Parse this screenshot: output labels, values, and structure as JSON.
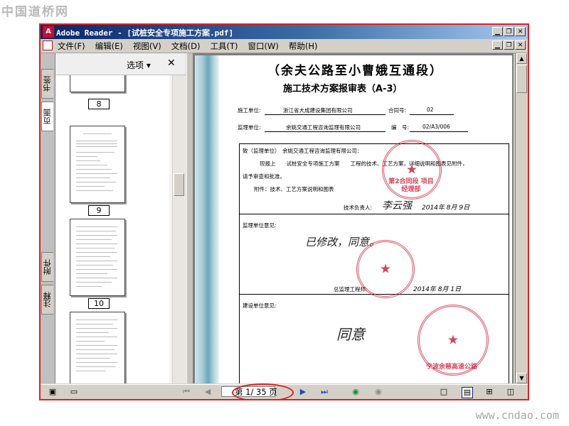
{
  "watermarks": {
    "top": "中国道桥网",
    "bottom": "www.cndao.com"
  },
  "window": {
    "title": "Adobe Reader - [试桩安全专项施工方案.pdf]",
    "controls": {
      "minimize": "▁",
      "restore": "❐",
      "close": "✕"
    }
  },
  "menu": {
    "items": [
      "文件(F)",
      "编辑(E)",
      "视图(V)",
      "文档(D)",
      "工具(T)",
      "窗口(W)",
      "帮助(H)"
    ]
  },
  "side_tabs": {
    "bookmarks": "书签",
    "pages": "页面",
    "attachments": "附件",
    "comments": "注释"
  },
  "panel": {
    "options_label": "选项 ▾",
    "close_label": "✕",
    "page_numbers": [
      "8",
      "9",
      "10"
    ]
  },
  "document": {
    "title": "（余夫公路至小曹娥互通段）",
    "subtitle": "施工技术方案报审表（A-3）",
    "construction_unit_label": "施工单位:",
    "construction_unit": "浙江省大成建设集团有限公司",
    "contract_no_label": "合同号:",
    "contract_no": "02",
    "supervision_unit_label": "监理单位:",
    "supervision_unit": "余姚交通工程咨询监理有限公司",
    "serial_label": "编　号:",
    "serial": "02/A3/006",
    "to_label": "致（监理单位）",
    "to_value": "余姚交通工程咨询监理有限公司：",
    "body_line1": "现报上　　试桩安全专项施工方案　　工程的技术、工艺方案，详细说明和图表见附件，",
    "body_line2": "请予审查和批准。",
    "attachment_line": "附件：技术、工艺方案说明和图表",
    "tech_lead_label": "技术负责人:",
    "tech_lead_date": "2014年 8月 9日",
    "supervision_opinion_label": "监理单位意见:",
    "supervision_opinion_text": "已修改，同意。",
    "chief_engineer_label": "总监理工程师:",
    "chief_date": "2014年 8月 1日",
    "owner_opinion_label": "建设单位意见:",
    "owner_opinion_text": "同意",
    "stamp1_text": "第2合同段 项目经理部",
    "stamp3_text": "宁波余慈高速公路"
  },
  "statusbar": {
    "page_display": "第 1/ 35 页"
  },
  "colors": {
    "highlight_red": "#e02020",
    "title_blue": "#0a246a",
    "stamp_red": "#d41e3c"
  }
}
